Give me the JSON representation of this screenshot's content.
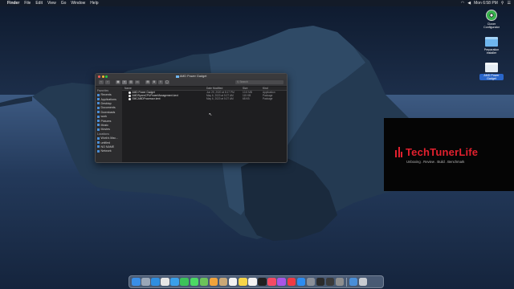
{
  "menubar": {
    "app_name": "Finder",
    "items": [
      "File",
      "Edit",
      "View",
      "Go",
      "Window",
      "Help"
    ],
    "clock": "Mon 6:58 PM"
  },
  "desktop_icons": [
    {
      "label": "Clover Configurator",
      "icon": "disk-icon"
    },
    {
      "label": "Preparation installer",
      "icon": "folder-icon"
    },
    {
      "label": "AMD Power Gadget",
      "icon": "folder-icon"
    }
  ],
  "finder": {
    "title": "AMD Power Gadget",
    "search_placeholder": "Search",
    "sidebar": {
      "favorites_header": "Favorites",
      "favorites": [
        "Recents",
        "Applications",
        "Desktop",
        "Documents",
        "Downloads",
        "work",
        "Pictures",
        "Music",
        "Movies"
      ],
      "locations_header": "Locations",
      "locations": [
        "Work's Mac...",
        "untitled",
        "NO NAME",
        "Network"
      ]
    },
    "columns": {
      "name": "Name",
      "date": "Date Modified",
      "size": "Size",
      "kind": "Kind"
    },
    "files": [
      {
        "name": "AMD Power Gadget",
        "date": "Jun 29, 2020 at 8:17 PM",
        "size": "10.5 MB",
        "kind": "Application"
      },
      {
        "name": "AMDRyzenCPUPowerManagement.kext",
        "date": "May 6, 2020 at 5:27 AM",
        "size": "115 KB",
        "kind": "Package"
      },
      {
        "name": "SMCAMDProcessor.kext",
        "date": "May 6, 2020 at 5:27 AM",
        "size": "68 KB",
        "kind": "Package"
      }
    ]
  },
  "brand": {
    "name": "TechTunerLife",
    "tagline": "Unboxing . Review . Build . Benchmark"
  },
  "dock": {
    "items": [
      {
        "name": "finder",
        "color": "#3a8ee6"
      },
      {
        "name": "launchpad",
        "color": "#9aa7b8"
      },
      {
        "name": "safari",
        "color": "#2f8ee0"
      },
      {
        "name": "chrome",
        "color": "#e6e6e6"
      },
      {
        "name": "mail",
        "color": "#3aa0ea"
      },
      {
        "name": "facetime",
        "color": "#3cc35a"
      },
      {
        "name": "messages",
        "color": "#4cd964"
      },
      {
        "name": "maps",
        "color": "#6cc35a"
      },
      {
        "name": "photos",
        "color": "#f0a33b"
      },
      {
        "name": "contacts",
        "color": "#c9a877"
      },
      {
        "name": "calendar",
        "color": "#f2f2f2"
      },
      {
        "name": "notes",
        "color": "#f7d548"
      },
      {
        "name": "reminders",
        "color": "#f2f2f2"
      },
      {
        "name": "tv",
        "color": "#202020"
      },
      {
        "name": "music",
        "color": "#f44b63"
      },
      {
        "name": "podcasts",
        "color": "#a855e6"
      },
      {
        "name": "news",
        "color": "#ef3b44"
      },
      {
        "name": "app-store",
        "color": "#2d8cf0"
      },
      {
        "name": "system-preferences",
        "color": "#8a8f98"
      },
      {
        "name": "terminal",
        "color": "#2b2b2b"
      },
      {
        "name": "obs",
        "color": "#3a3a3a"
      },
      {
        "name": "disk-utility",
        "color": "#8e8e8e"
      },
      {
        "name": "downloads-stack",
        "color": "#4a8fd8"
      },
      {
        "name": "trash",
        "color": "#c8ccd2"
      }
    ]
  }
}
